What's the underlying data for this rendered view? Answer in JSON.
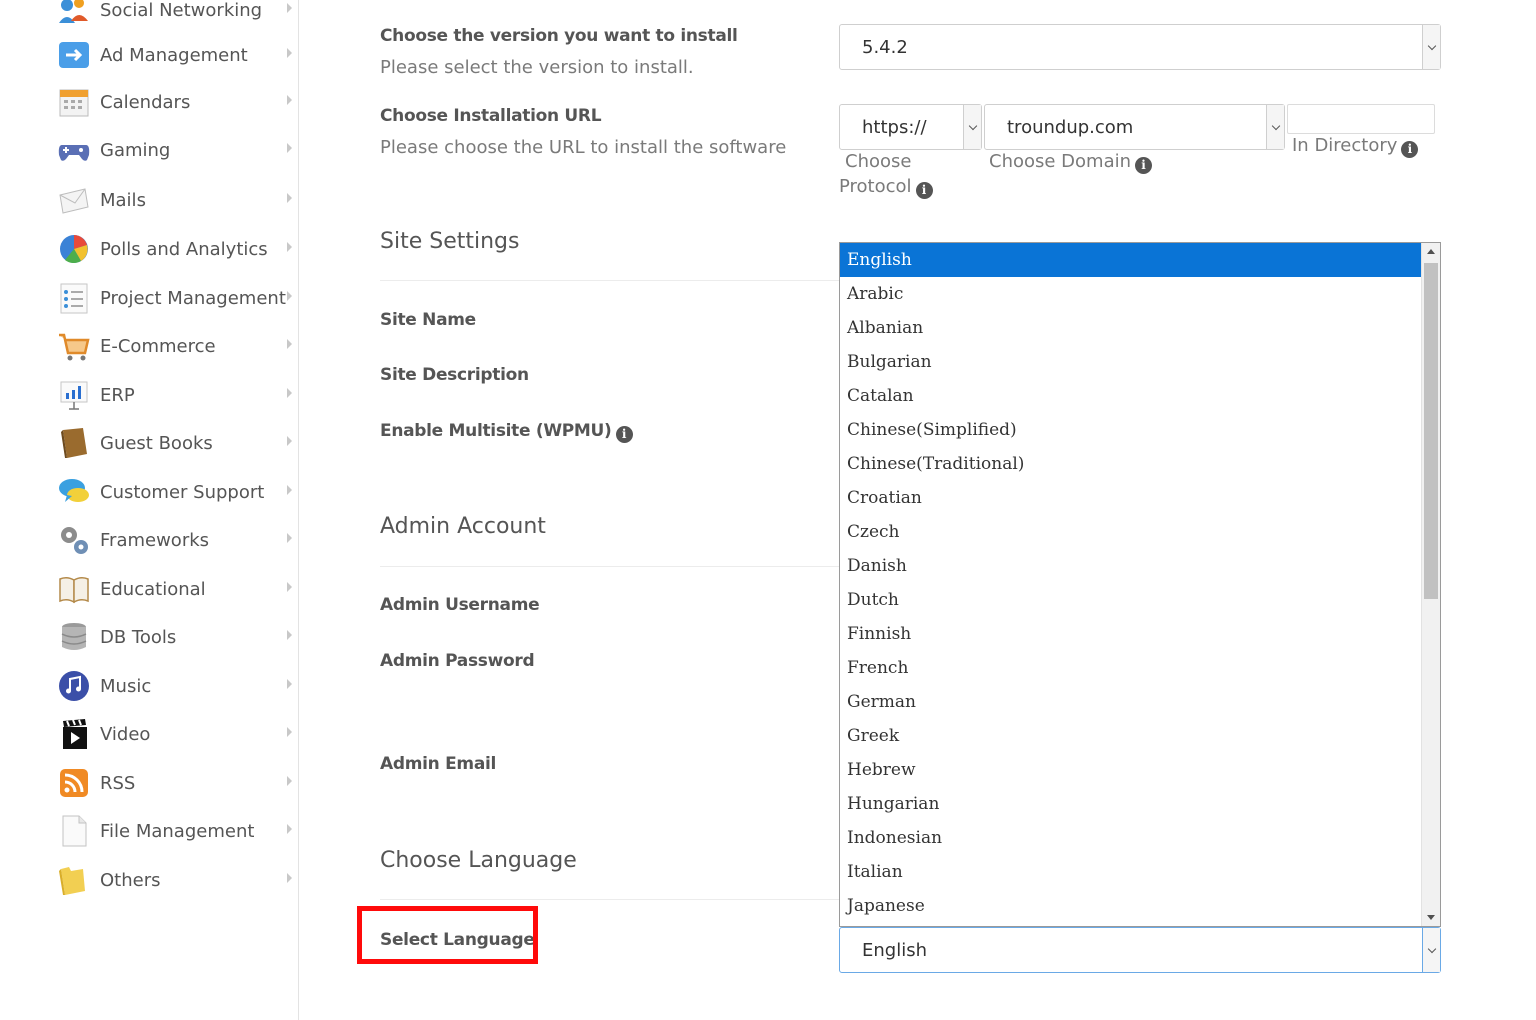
{
  "sidebar": {
    "items": [
      {
        "label": "Social Networking",
        "icon": "social-networking-icon"
      },
      {
        "label": "Ad Management",
        "icon": "ad-management-icon"
      },
      {
        "label": "Calendars",
        "icon": "calendar-icon"
      },
      {
        "label": "Gaming",
        "icon": "gamepad-icon"
      },
      {
        "label": "Mails",
        "icon": "mail-icon"
      },
      {
        "label": "Polls and Analytics",
        "icon": "pie-chart-icon"
      },
      {
        "label": "Project Management",
        "icon": "checklist-icon"
      },
      {
        "label": "E-Commerce",
        "icon": "shopping-cart-icon"
      },
      {
        "label": "ERP",
        "icon": "bar-chart-icon"
      },
      {
        "label": "Guest Books",
        "icon": "book-icon"
      },
      {
        "label": "Customer Support",
        "icon": "chat-bubbles-icon"
      },
      {
        "label": "Frameworks",
        "icon": "gears-icon"
      },
      {
        "label": "Educational",
        "icon": "open-book-icon"
      },
      {
        "label": "DB Tools",
        "icon": "database-icon"
      },
      {
        "label": "Music",
        "icon": "music-note-icon"
      },
      {
        "label": "Video",
        "icon": "clapperboard-icon"
      },
      {
        "label": "RSS",
        "icon": "rss-icon"
      },
      {
        "label": "File Management",
        "icon": "file-icon"
      },
      {
        "label": "Others",
        "icon": "folder-icon"
      }
    ]
  },
  "form": {
    "version": {
      "label": "Choose the version you want to install",
      "help": "Please select the version to install.",
      "value": "5.4.2"
    },
    "url": {
      "label": "Choose Installation URL",
      "help": "Please choose the URL to install the software",
      "protocol_value": "https://",
      "protocol_caption_1": "Choose",
      "protocol_caption_2": "Protocol",
      "domain_value": "troundup.com",
      "domain_caption": "Choose Domain",
      "directory_value": "",
      "directory_caption": "In Directory"
    },
    "site_settings": {
      "title": "Site Settings",
      "site_name_label": "Site Name",
      "site_description_label": "Site Description",
      "multisite_label": "Enable Multisite (WPMU)"
    },
    "admin_account": {
      "title": "Admin Account",
      "username_label": "Admin Username",
      "password_label": "Admin Password",
      "email_label": "Admin Email"
    },
    "language": {
      "title": "Choose Language",
      "label": "Select Language",
      "value": "English",
      "options": [
        "English",
        "Arabic",
        "Albanian",
        "Bulgarian",
        "Catalan",
        "Chinese(Simplified)",
        "Chinese(Traditional)",
        "Croatian",
        "Czech",
        "Danish",
        "Dutch",
        "Finnish",
        "French",
        "German",
        "Greek",
        "Hebrew",
        "Hungarian",
        "Indonesian",
        "Italian",
        "Japanese"
      ],
      "selected_index": 0
    }
  },
  "colors": {
    "selected_option": "#0a74d6",
    "highlight": "#ff0a0a",
    "focus_border": "#6aa9e6"
  }
}
